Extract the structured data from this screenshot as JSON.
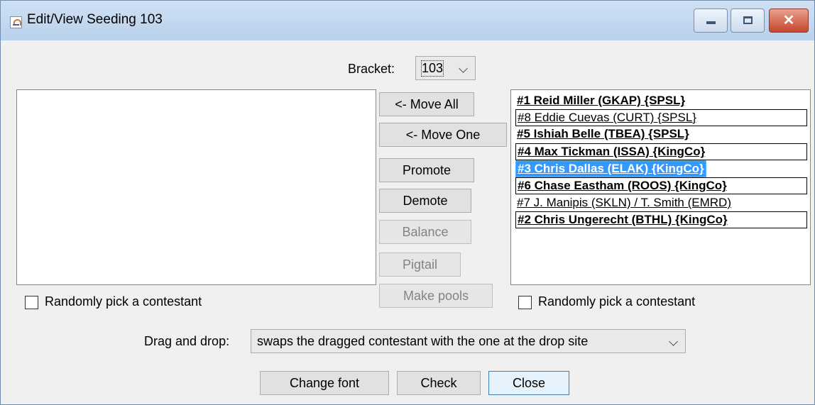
{
  "window": {
    "title": "Edit/View Seeding 103"
  },
  "bracket": {
    "label": "Bracket:",
    "selected": "103"
  },
  "left_panel": {
    "random_pick_label": "Randomly pick a contestant"
  },
  "center_buttons": {
    "move_all": "<- Move All",
    "move_one": "<- Move One",
    "promote": "Promote",
    "demote": "Demote",
    "balance": "Balance",
    "pigtail": "Pigtail",
    "make_pools": "Make pools"
  },
  "right_panel": {
    "entries": [
      {
        "text": "#1 Reid Miller (GKAP) {SPSL}",
        "bold": true,
        "boxed": false,
        "selected": false
      },
      {
        "text": "#8 Eddie Cuevas (CURT) {SPSL}",
        "bold": false,
        "boxed": true,
        "selected": false
      },
      {
        "text": "#5 Ishiah Belle (TBEA) {SPSL}",
        "bold": true,
        "boxed": false,
        "selected": false
      },
      {
        "text": "#4 Max Tickman (ISSA) {KingCo}",
        "bold": true,
        "boxed": true,
        "selected": false
      },
      {
        "text": "#3 Chris Dallas (ELAK) {KingCo}",
        "bold": true,
        "boxed": false,
        "selected": true
      },
      {
        "text": "#6 Chase Eastham (ROOS) {KingCo}",
        "bold": true,
        "boxed": true,
        "selected": false
      },
      {
        "text": "#7 J. Manipis (SKLN) / T. Smith (EMRD)",
        "bold": false,
        "boxed": false,
        "selected": false
      },
      {
        "text": "#2 Chris Ungerecht (BTHL) {KingCo}",
        "bold": true,
        "boxed": true,
        "selected": false
      }
    ],
    "random_pick_label": "Randomly pick a contestant"
  },
  "drag_drop": {
    "label": "Drag and drop:",
    "selected": "swaps the dragged contestant with the one at the drop site"
  },
  "footer": {
    "change_font": "Change font",
    "check": "Check",
    "close": "Close"
  }
}
